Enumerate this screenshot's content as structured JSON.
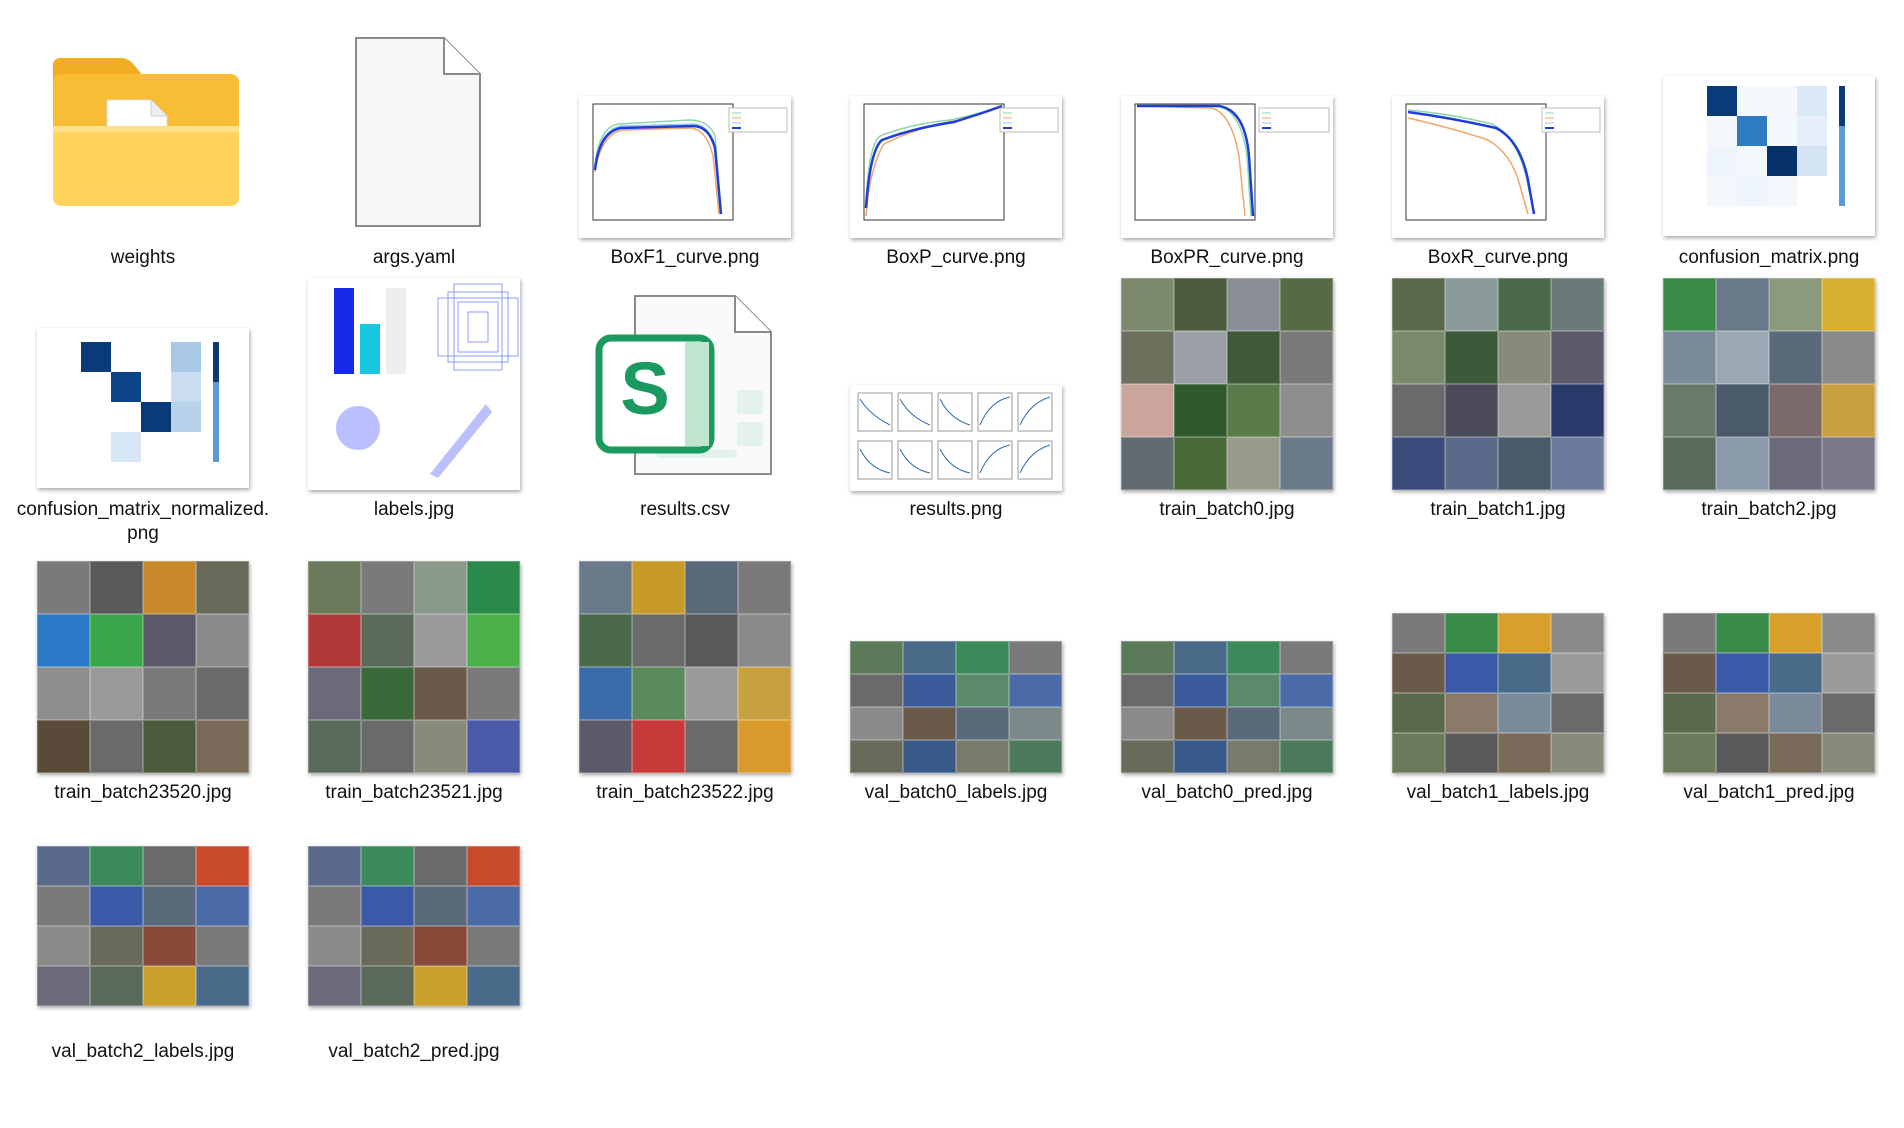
{
  "files": [
    {
      "name": "weights",
      "kind": "folder"
    },
    {
      "name": "args.yaml",
      "kind": "blank-file"
    },
    {
      "name": "BoxF1_curve.png",
      "kind": "curve"
    },
    {
      "name": "BoxP_curve.png",
      "kind": "curve"
    },
    {
      "name": "BoxPR_curve.png",
      "kind": "curve"
    },
    {
      "name": "BoxR_curve.png",
      "kind": "curve"
    },
    {
      "name": "confusion_matrix.png",
      "kind": "matrix"
    },
    {
      "name": "confusion_matrix_normalized.png",
      "kind": "matrix"
    },
    {
      "name": "labels.jpg",
      "kind": "labels-plot"
    },
    {
      "name": "results.csv",
      "kind": "spreadsheet"
    },
    {
      "name": "results.png",
      "kind": "results-plot"
    },
    {
      "name": "train_batch0.jpg",
      "kind": "mosaic"
    },
    {
      "name": "train_batch1.jpg",
      "kind": "mosaic"
    },
    {
      "name": "train_batch2.jpg",
      "kind": "mosaic"
    },
    {
      "name": "train_batch23520.jpg",
      "kind": "mosaic"
    },
    {
      "name": "train_batch23521.jpg",
      "kind": "mosaic"
    },
    {
      "name": "train_batch23522.jpg",
      "kind": "mosaic"
    },
    {
      "name": "val_batch0_labels.jpg",
      "kind": "mosaic-wide"
    },
    {
      "name": "val_batch0_pred.jpg",
      "kind": "mosaic-wide"
    },
    {
      "name": "val_batch1_labels.jpg",
      "kind": "mosaic"
    },
    {
      "name": "val_batch1_pred.jpg",
      "kind": "mosaic"
    },
    {
      "name": "val_batch2_labels.jpg",
      "kind": "mosaic"
    },
    {
      "name": "val_batch2_pred.jpg",
      "kind": "mosaic"
    }
  ],
  "icons": {
    "folder": "folder-icon",
    "blank_file": "file-icon",
    "spreadsheet": "spreadsheet-icon",
    "spreadsheet_letter": "S"
  },
  "colors": {
    "folder_back": "#f5b82e",
    "folder_front": "#ffd25e",
    "spreadsheet_green": "#1a9a5e",
    "plot_blue": "#1c3fd8",
    "matrix_dark": "#0b3a78"
  }
}
